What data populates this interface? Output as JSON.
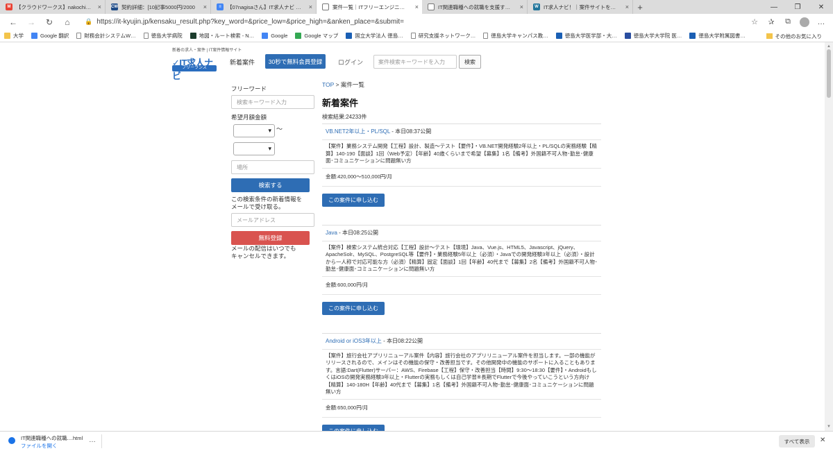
{
  "browser": {
    "tabs": [
      {
        "title": "【クラウドワークス】nakochiさんから…",
        "icon": "gmail-icon",
        "color": "#ea4335",
        "glyph": "M"
      },
      {
        "title": "契約詳細：[10記事5000円/2000",
        "icon": "crowdworks-icon",
        "color": "#1d4a87",
        "glyph": "CW"
      },
      {
        "title": "【07nagisaさん】IT求人ナビ 記事",
        "icon": "docs-icon",
        "color": "#4285f4",
        "glyph": "≡"
      },
      {
        "title": "案件一覧｜ITフリーエンジニア案件を",
        "icon": "page-icon",
        "color": "#ffffff",
        "glyph": ""
      },
      {
        "title": "IT関連職種への就職を支援するIT",
        "icon": "page-icon",
        "color": "#ffffff",
        "glyph": ""
      },
      {
        "title": "IT求人ナビ！｜案件サイトを徹底比",
        "icon": "wordpress-icon",
        "color": "#21759b",
        "glyph": "W"
      }
    ],
    "active_tab": 3,
    "new_tab": "+",
    "url": "https://it-kyujin.jp/kensaku_result.php?key_word=&price_low=&price_high=&anken_place=&submit=",
    "bookmarks": [
      {
        "label": "大学",
        "icon": "folder-icon"
      },
      {
        "label": "Google 翻訳",
        "icon": "translate-icon"
      },
      {
        "label": "財務会計システムW…",
        "icon": "page-icon"
      },
      {
        "label": "徳島大学病院",
        "icon": "page-icon"
      },
      {
        "label": "地図・ルート検索 - N…",
        "icon": "navitime-icon"
      },
      {
        "label": "Google",
        "icon": "google-icon"
      },
      {
        "label": "Google マップ",
        "icon": "maps-icon"
      },
      {
        "label": "国立大学法人 徳島…",
        "icon": "univ-icon"
      },
      {
        "label": "研究支援ネットワーク…",
        "icon": "page-icon"
      },
      {
        "label": "徳島大学キャンパス教…",
        "icon": "page-icon"
      },
      {
        "label": "徳島大学医学部・大…",
        "icon": "univ-icon"
      },
      {
        "label": "徳島大学大学院 医…",
        "icon": "univ17-icon"
      },
      {
        "label": "徳島大学附属図書…",
        "icon": "univ-icon"
      }
    ],
    "other_bookmarks": "その他のお気に入り"
  },
  "header": {
    "tagline": "新着の求人・案件 | IT案件情報サイト",
    "logo_main": "IT求人ナビ",
    "logo_sub": "フリーランス",
    "nav_new": "新着案件",
    "register": "30秒で無料会員登録",
    "login": "ログイン",
    "search_placeholder": "案件検索キーワードを入力",
    "search_button": "検索"
  },
  "sidebar": {
    "freeword_label": "フリーワード",
    "freeword_placeholder": "検索キーワード入力",
    "price_label": "希望月額金額",
    "tilde": "〜",
    "place_placeholder": "場所",
    "search_button": "検索する",
    "notify_text": "この検索条件の新着情報を\nメールで受け取る。",
    "email_placeholder": "メールアドレス",
    "free_register": "無料登録",
    "cancel_note": "メールの配信はいつでも\nキャンセルできます。"
  },
  "main": {
    "breadcrumb_top": "TOP",
    "breadcrumb_sep": " > ",
    "breadcrumb_current": "案件一覧",
    "title": "新着案件",
    "result_count": "検索結果:24233件",
    "listings": [
      {
        "skill": "VB.NET2年以上・PL/SQL",
        "published": " - 本日08:37公開",
        "description": "【案件】業務システム開発【工程】設計、製造〜テスト【要件】・VB.NET開発経験2年以上・PL/SQLの実務経験【精算】140-190【面談】1回（Web予定）【年齢】40歳くらいまで希望【募集】1名【備考】外国籍不可人物･勤怠･健康面･コミュニケーションに問題無い方",
        "salary": "金額:420,000〜510,000円/月",
        "apply": "この案件に申し込む"
      },
      {
        "skill": "Java",
        "published": " - 本日08:25公開",
        "description": "【案件】検索システム統合対応【工程】設計〜テスト【環境】Java、Vue.js、HTML5、Javascript、jQuery、ApacheSolr、MySQL、PostgreSQL等【要件】・業務経験5年以上（必須）・Javaでの開発経験3年以上（必須）・設計から一人称で対応可能な方（必須）【精算】固定【面談】1回【年齢】40代まで【募集】2名【備考】外国籍不可人物･勤怠･健康面･コミュニケーションに問題無い方",
        "salary": "金額:600,000円/月",
        "apply": "この案件に申し込む"
      },
      {
        "skill": "Android or iOS3年以上",
        "published": " - 本日08:22公開",
        "description": "【案件】旅行会社アプリリニューアル案件【内容】旅行会社のアプリリニューアル案件を担当します。一部の機能がリリースされるので、メインはその機能の保守・改善担当です。その他開発中の機能のサポートに入ることもあります。言語:Dart(Flutter)サーバー：AWS、Firebase【工程】保守・改善担当【時間】9:30〜18:30【要件】・AndroidもしくはiOSの開発実務経験3年以上・Flutterの実務もしくは自己学習※長期でFlutterで今後やっていこうという方向け【精算】140-180H【年齢】40代まで【募集】1名【備考】外国籍不可人物･勤怠･健康面･コミュニケーションに問題無い方",
        "salary": "金額:650,000円/月",
        "apply": "この案件に申し込む"
      }
    ]
  },
  "download": {
    "filename": "IT関連職種への就職....html",
    "open_link": "ファイルを開く",
    "show_all": "すべて表示",
    "more": "…"
  },
  "colors": {
    "primary": "#2e6db4",
    "danger": "#d9534f"
  }
}
